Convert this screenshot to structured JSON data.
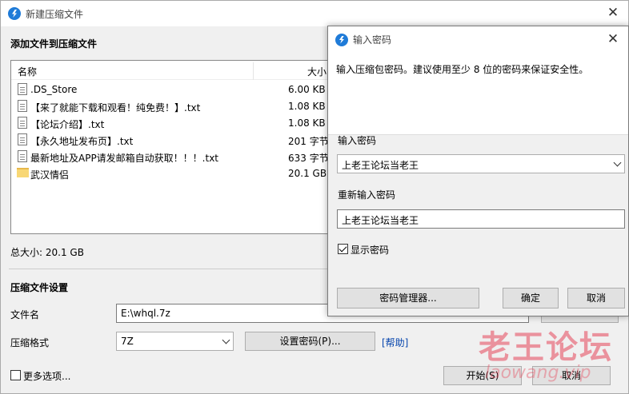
{
  "main": {
    "title": "新建压缩文件",
    "add_section": "添加文件到压缩文件",
    "columns": {
      "name": "名称",
      "size": "大小"
    },
    "files": [
      {
        "name": ".DS_Store",
        "size": "6.00 KB",
        "type": "file"
      },
      {
        "name": "【来了就能下载和观看！纯免费！】.txt",
        "size": "1.08 KB",
        "type": "file"
      },
      {
        "name": "【论坛介绍】.txt",
        "size": "1.08 KB",
        "type": "file"
      },
      {
        "name": "【永久地址发布页】.txt",
        "size": "201 字节",
        "type": "file"
      },
      {
        "name": "最新地址及APP请发邮箱自动获取！！！.txt",
        "size": "633 字节",
        "type": "file"
      },
      {
        "name": "武汉情侣",
        "size": "20.1 GB",
        "type": "folder"
      }
    ],
    "total": "总大小: 20.1 GB",
    "settings_section": "压缩文件设置",
    "filename_label": "文件名",
    "filename_value": "E:\\whql.7z",
    "format_label": "压缩格式",
    "format_value": "7Z",
    "set_password_button": "设置密码(P)...",
    "help_link": "[帮助]",
    "more_options": "更多选项...",
    "start_button": "开始(S)",
    "cancel_button": "取消"
  },
  "password_dialog": {
    "title": "输入密码",
    "description": "输入压缩包密码。建议使用至少 8 位的密码来保证安全性。",
    "enter_label": "输入密码",
    "enter_value": "上老王论坛当老王",
    "reenter_label": "重新输入密码",
    "reenter_value": "上老王论坛当老王",
    "show_password": "显示密码",
    "show_password_checked": true,
    "manager_button": "密码管理器...",
    "ok_button": "确定",
    "cancel_button": "取消"
  },
  "watermark": {
    "text": "老王论坛",
    "sub": "laowang.vip"
  },
  "colors": {
    "accent": "#1f7bd8",
    "watermark": "#e6465a"
  }
}
